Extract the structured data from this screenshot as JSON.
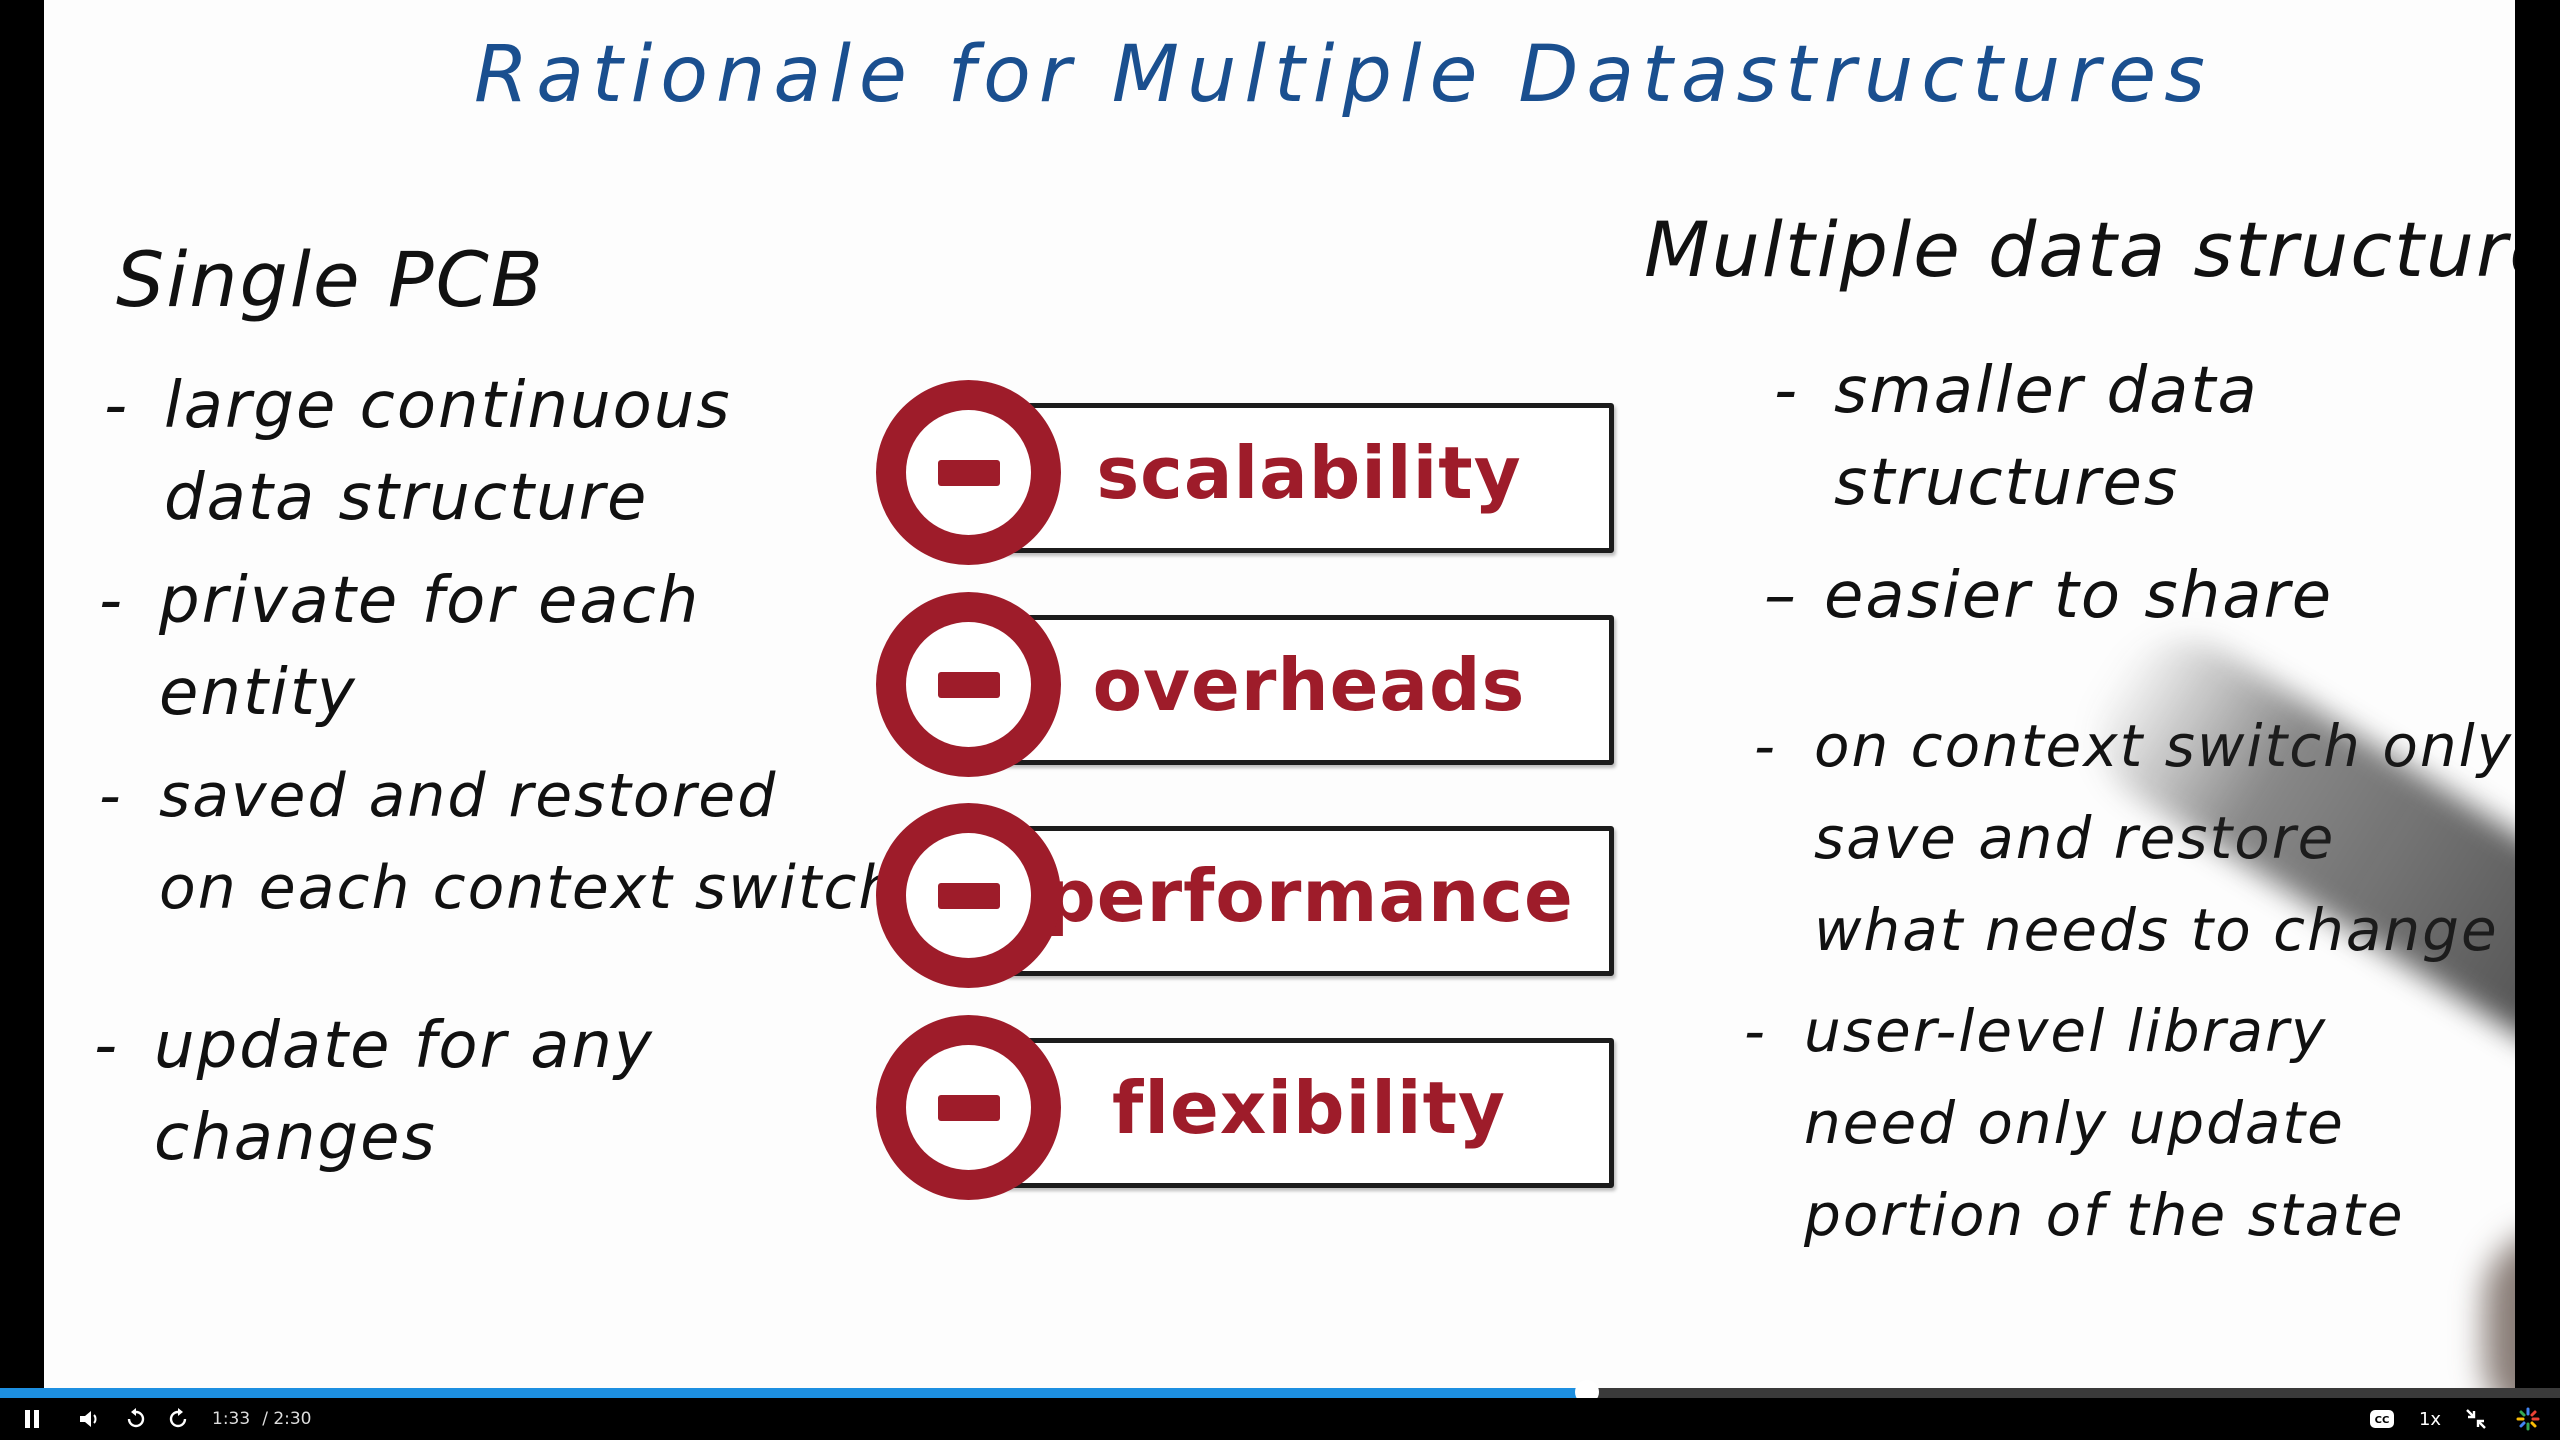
{
  "lesson": {
    "title": "Rationale for Multiple Datastructures",
    "left": {
      "heading": "Single PCB",
      "bullets": [
        [
          "large continuous",
          "data structure"
        ],
        [
          "private for each",
          "entity"
        ],
        [
          "saved and restored",
          "on each context switch"
        ],
        [
          "update for any",
          "changes"
        ]
      ]
    },
    "center": {
      "items": [
        "scalability",
        "overheads",
        "performance",
        "flexibility"
      ]
    },
    "right": {
      "heading": "Multiple data structures",
      "bullets": [
        [
          "smaller data",
          "structures"
        ],
        [
          "easier to share"
        ],
        [
          "on context switch only",
          "save and restore",
          "what needs to change"
        ],
        [
          "user-level library",
          "need only update",
          "portion of the state"
        ]
      ]
    },
    "colors": {
      "title": "#1a4f8f",
      "accent": "#9e1c2a"
    }
  },
  "player": {
    "current_time": "1:33",
    "duration": "/ 2:30",
    "speed": "1x",
    "progress": 0.62,
    "icons": {
      "play_pause": "pause-icon",
      "volume": "volume-icon",
      "rewind": "rewind-icon",
      "forward": "forward-icon",
      "captions": "cc-icon",
      "fullscreen": "exit-fullscreen-icon",
      "brand": "brand-icon"
    }
  }
}
